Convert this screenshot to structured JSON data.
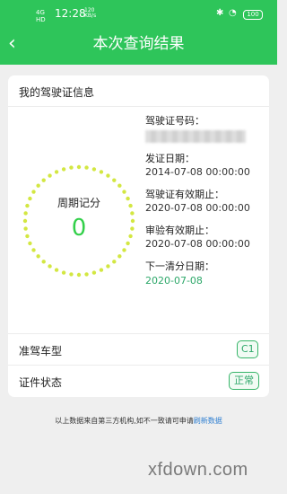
{
  "status_bar": {
    "signal": "4G",
    "signal_sub": "HD",
    "time": "12:28",
    "network_rate": "120",
    "network_unit": "KB/s",
    "battery": "100"
  },
  "header": {
    "back_icon": "chevron-left-icon",
    "title": "本次查询结果"
  },
  "card": {
    "title": "我的驾驶证信息",
    "score_label": "周期记分",
    "score_value": "0",
    "info": [
      {
        "label": "驾驶证号码：",
        "value": ""
      },
      {
        "label": "发证日期：",
        "value": "2014-07-08 00:00:00"
      },
      {
        "label": "驾驶证有效期止：",
        "value": "2020-07-08 00:00:00"
      },
      {
        "label": "审验有效期止：",
        "value": "2020-07-08 00:00:00"
      },
      {
        "label": "下一清分日期：",
        "value": "2020-07-08"
      }
    ],
    "rows": [
      {
        "label": "准驾车型",
        "tag": "C1"
      },
      {
        "label": "证件状态",
        "tag": "正常"
      }
    ]
  },
  "footnote": {
    "text": "以上数据来自第三方机构,如不一致请可申请",
    "link": "刷新数据"
  },
  "watermark": "xfdown.com",
  "colors": {
    "header_bg": "#2ec55a",
    "score_green": "#33d04a",
    "tag_green": "#2ea86a",
    "link_blue": "#2f7fd1"
  }
}
